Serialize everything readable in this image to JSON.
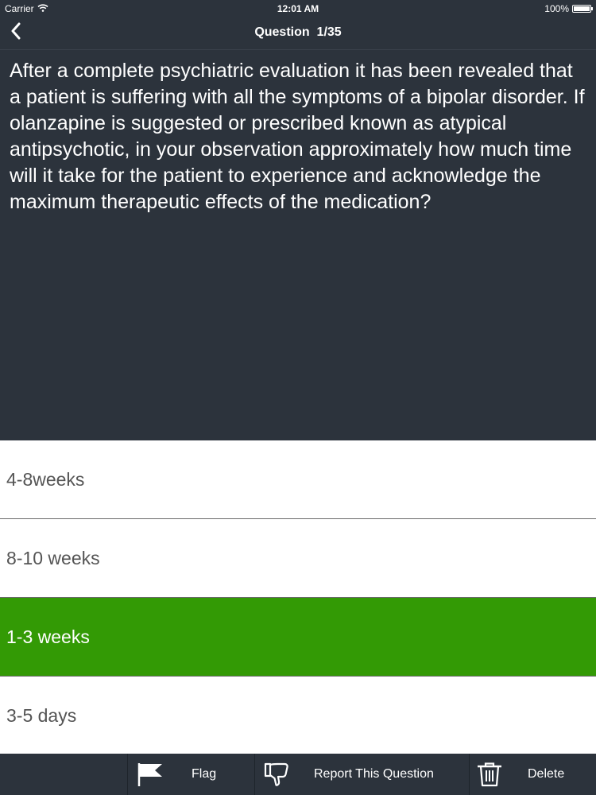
{
  "status_bar": {
    "carrier": "Carrier",
    "time": "12:01 AM",
    "battery": "100%"
  },
  "nav": {
    "title": "Question  1/35"
  },
  "question": {
    "text": "After a complete psychiatric evaluation it has been revealed that a patient is suffering with all the symptoms of a bipolar disorder. If olanzapine is suggested or prescribed known as atypical antipsychotic, in your observation approximately how much time will it take for the patient to experience and acknowledge the maximum therapeutic effects of the medication?"
  },
  "answers": [
    {
      "label": "4-8weeks",
      "selected": false
    },
    {
      "label": "8-10 weeks",
      "selected": false
    },
    {
      "label": "1-3 weeks",
      "selected": true
    },
    {
      "label": "3-5 days",
      "selected": false
    }
  ],
  "toolbar": {
    "flag_label": "Flag",
    "report_label": "Report This Question",
    "delete_label": "Delete"
  },
  "colors": {
    "background": "#2c333c",
    "selected_answer": "#339a05",
    "answer_text": "#555555"
  },
  "icons": {
    "back": "chevron-left-icon",
    "wifi": "wifi-icon",
    "battery": "battery-icon",
    "flag": "flag-icon",
    "report": "thumbs-down-icon",
    "delete": "trash-icon"
  }
}
